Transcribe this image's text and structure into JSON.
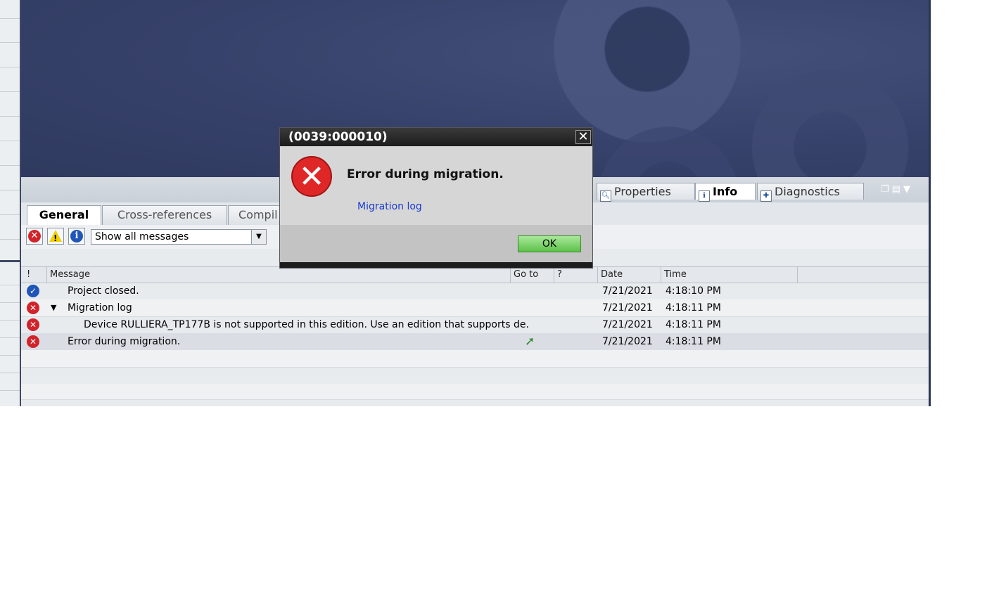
{
  "dialog": {
    "title": "(0039:000010)",
    "close_glyph": "✕",
    "message": "Error during migration.",
    "link": "Migration log",
    "ok_label": "OK"
  },
  "inspector_tabs": {
    "properties": "Properties",
    "info": "Info",
    "diagnostics": "Diagnostics"
  },
  "sub_tabs": [
    "General",
    "Cross-references",
    "Compil"
  ],
  "toolbar": {
    "filter_value": "Show all messages"
  },
  "grid": {
    "headers": {
      "status": "!",
      "message": "Message",
      "goto": "Go to",
      "help": "?",
      "date": "Date",
      "time": "Time"
    },
    "rows": [
      {
        "status": "ok",
        "message": "Project closed.",
        "date": "7/21/2021",
        "time": "4:18:10 PM"
      },
      {
        "status": "error",
        "message": "Migration log",
        "date": "7/21/2021",
        "time": "4:18:11 PM"
      },
      {
        "status": "error",
        "message": "Device RULLIERA_TP177B is not supported in this edition. Use an edition that supports de.",
        "date": "7/21/2021",
        "time": "4:18:11 PM"
      },
      {
        "status": "error",
        "message": "Error during migration.",
        "date": "7/21/2021",
        "time": "4:18:11 PM"
      }
    ]
  },
  "colors": {
    "error": "#d2232a",
    "info": "#1f56b8",
    "ok_button": "#5cc14a",
    "portal_bg": "#36416a"
  }
}
